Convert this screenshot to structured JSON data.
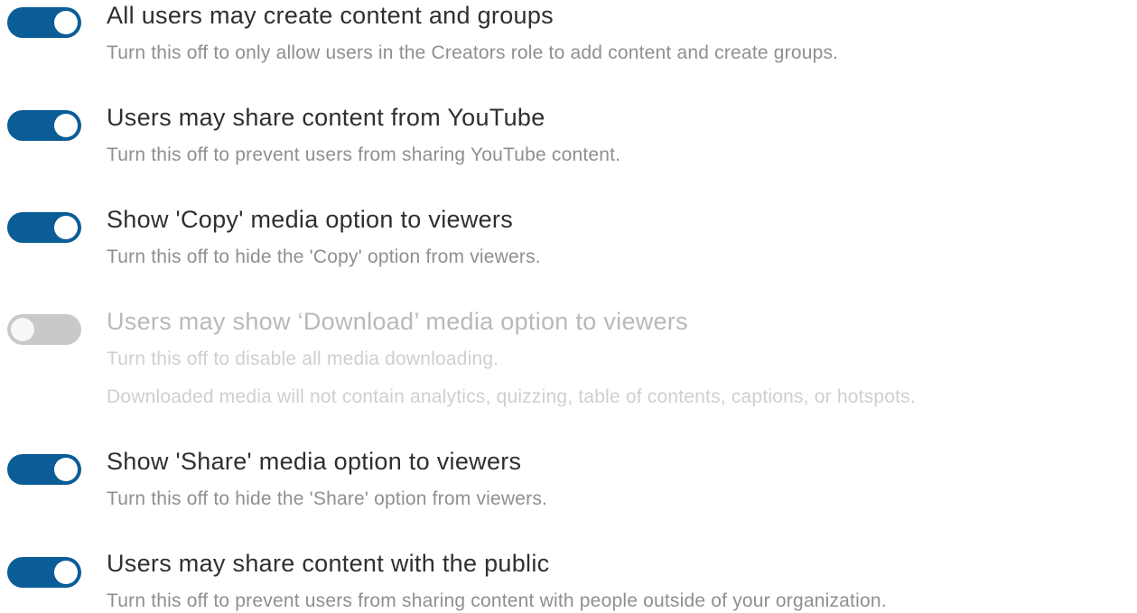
{
  "settings": [
    {
      "title": "All users may create content and groups",
      "description": "Turn this off to only allow users in the Creators role to add content and create groups.",
      "enabled": true
    },
    {
      "title": "Users may share content from YouTube",
      "description": "Turn this off to prevent users from sharing YouTube content.",
      "enabled": true
    },
    {
      "title": "Show 'Copy' media option to viewers",
      "description": "Turn this off to hide the 'Copy' option from viewers.",
      "enabled": true
    },
    {
      "title": "Users may show ‘Download’ media option to viewers",
      "description": "Turn this off to disable all media downloading.",
      "note": "Downloaded media will not contain analytics, quizzing, table of contents, captions, or hotspots.",
      "enabled": false
    },
    {
      "title": "Show 'Share' media option to viewers",
      "description": "Turn this off to hide the 'Share' option from viewers.",
      "enabled": true
    },
    {
      "title": "Users may share content with the public",
      "description": "Turn this off to prevent users from sharing content with people outside of your organization.",
      "enabled": true
    }
  ],
  "colors": {
    "toggle_on": "#0b5d97",
    "toggle_off": "#9e9e9e",
    "title": "#2f2f2f",
    "description": "#8f8f8f"
  }
}
